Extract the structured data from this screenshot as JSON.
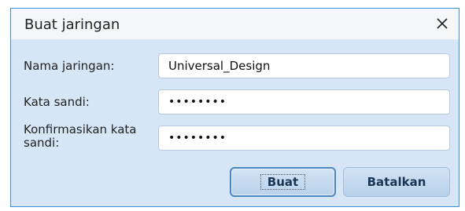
{
  "dialog": {
    "title": "Buat jaringan",
    "close_icon": "close-icon"
  },
  "form": {
    "network_name_label": "Nama jaringan:",
    "network_name_value": "Universal_Design",
    "password_label": "Kata sandi:",
    "password_value": "••••••••",
    "confirm_label": "Konfirmasikan kata sandi:",
    "confirm_value": "••••••••"
  },
  "buttons": {
    "create": "Buat",
    "cancel": "Batalkan"
  },
  "colors": {
    "dialog_bg": "#d6e6f6",
    "border": "#3d8fd9",
    "button": "#c5daf0"
  }
}
